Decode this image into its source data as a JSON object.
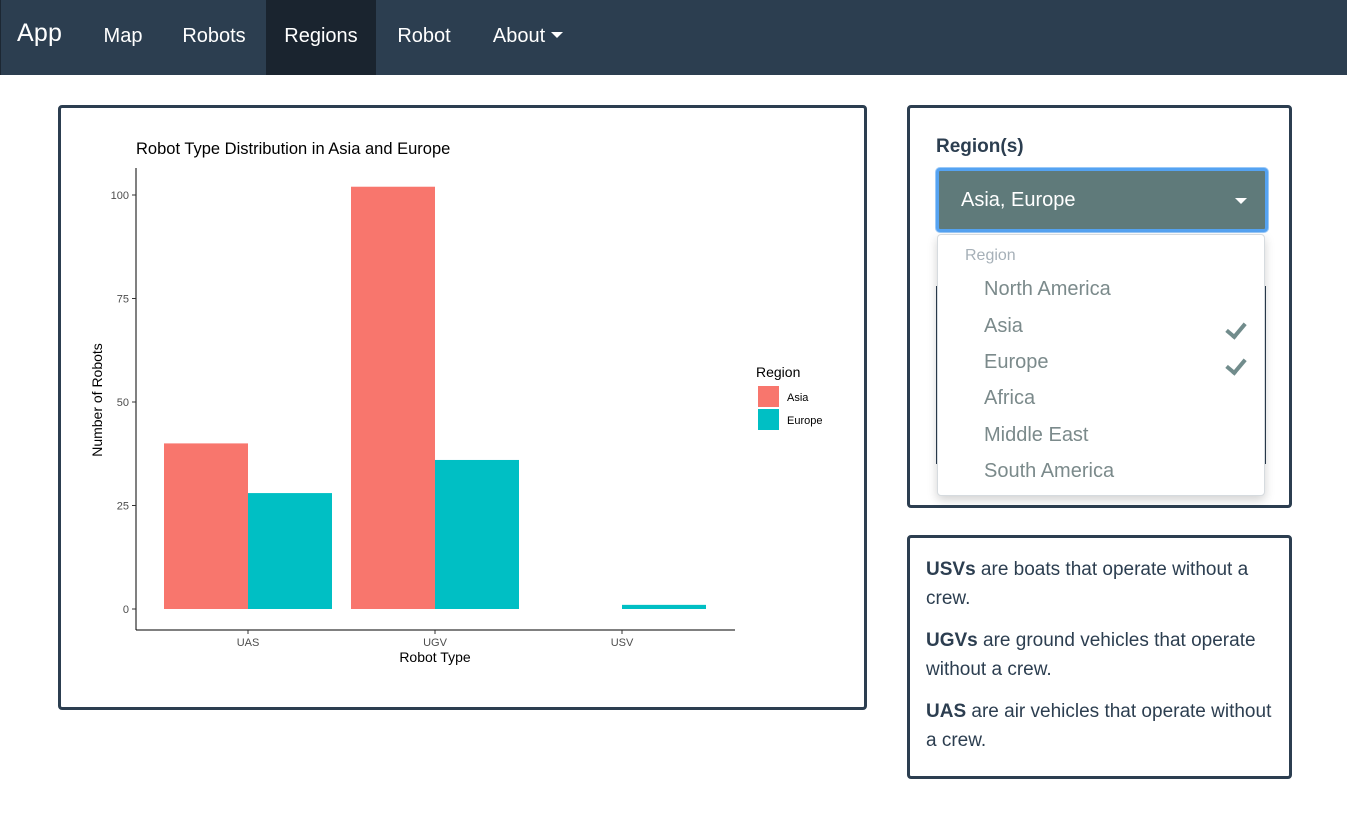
{
  "navbar": {
    "brand": "App",
    "items": [
      {
        "label": "Map",
        "active": false
      },
      {
        "label": "Robots",
        "active": false
      },
      {
        "label": "Regions",
        "active": true
      },
      {
        "label": "Robot",
        "active": false
      },
      {
        "label": "About",
        "active": false,
        "has_caret": true
      }
    ]
  },
  "filter": {
    "label": "Region(s)",
    "selected_text": "Asia, Europe",
    "dropdown": {
      "header": "Region",
      "options": [
        {
          "label": "North America",
          "checked": false
        },
        {
          "label": "Asia",
          "checked": true
        },
        {
          "label": "Europe",
          "checked": true
        },
        {
          "label": "Africa",
          "checked": false
        },
        {
          "label": "Middle East",
          "checked": false
        },
        {
          "label": "South America",
          "checked": false
        }
      ]
    }
  },
  "info": [
    {
      "term": "USVs",
      "text": " are boats that operate without a crew."
    },
    {
      "term": "UGVs",
      "text": " are ground vehicles that operate without a crew."
    },
    {
      "term": "UAS",
      "text": " are air vehicles that operate without a crew."
    }
  ],
  "chart_data": {
    "type": "bar",
    "title": "Robot Type Distribution in Asia and Europe",
    "xlabel": "Robot Type",
    "ylabel": "Number of Robots",
    "categories": [
      "UAS",
      "UGV",
      "USV"
    ],
    "series": [
      {
        "name": "Asia",
        "color": "#F8766D",
        "values": [
          40,
          102,
          0
        ]
      },
      {
        "name": "Europe",
        "color": "#00BFC4",
        "values": [
          28,
          36,
          1
        ]
      }
    ],
    "ylim": [
      0,
      100
    ],
    "yticks": [
      0,
      25,
      50,
      75,
      100
    ],
    "legend_title": "Region",
    "legend_position": "right",
    "grid": false
  }
}
